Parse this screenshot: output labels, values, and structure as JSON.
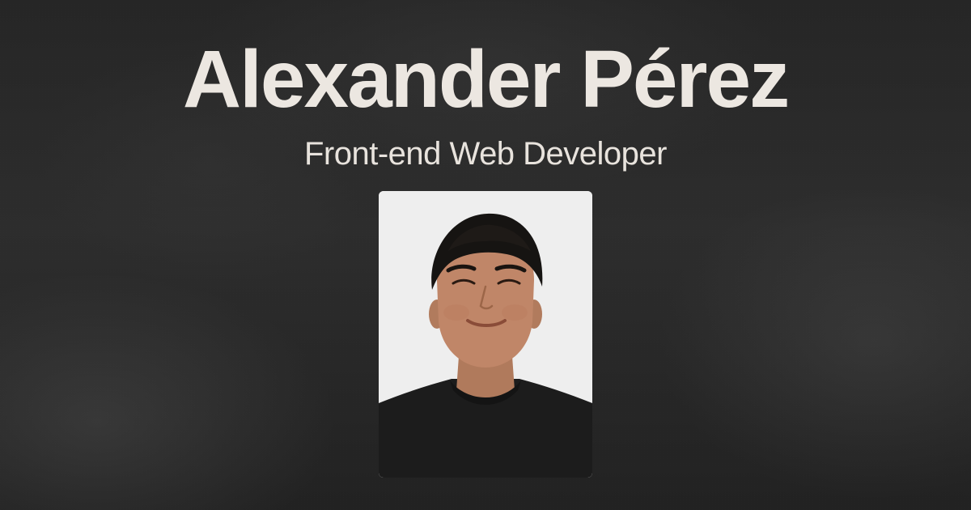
{
  "hero": {
    "name": "Alexander Pérez",
    "role": "Front-end Web Developer"
  },
  "colors": {
    "background": "#262626",
    "text_primary": "#ece7e1",
    "photo_bg": "#efefef"
  },
  "photo": {
    "icon": "portrait-photo"
  }
}
